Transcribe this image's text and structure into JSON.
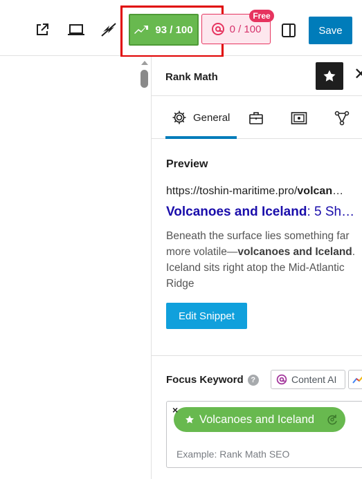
{
  "toolbar": {
    "score_label": "93 / 100",
    "content_ai_score": "0 / 100",
    "free_badge": "Free",
    "save_label": "Save"
  },
  "sidebar": {
    "title": "Rank Math",
    "tabs": {
      "general_label": "General"
    },
    "preview": {
      "heading": "Preview",
      "url_prefix": "https://toshin-maritime.pro/",
      "url_bold": "volcan",
      "url_ellipsis": "…",
      "title_bold": "Volcanoes and Iceland",
      "title_rest": ": 5 Sh…",
      "desc_part1": "Beneath the surface lies something far more volatile—",
      "desc_bold": "volcanoes and Iceland",
      "desc_part2": ". Iceland sits right atop the Mid-Atlantic Ridge",
      "edit_button": "Edit Snippet"
    },
    "focus_keyword": {
      "label": "Focus Keyword",
      "help": "?",
      "content_ai_label": "Content AI",
      "keyword": "Volcanoes and Iceland",
      "remove": "×",
      "placeholder": "Example: Rank Math SEO"
    }
  },
  "colors": {
    "accent": "#007cba",
    "score_green": "#68b94f",
    "content_ai_pink": "#e6345f",
    "link_blue": "#1a0dab",
    "highlight_red": "#e00000"
  }
}
